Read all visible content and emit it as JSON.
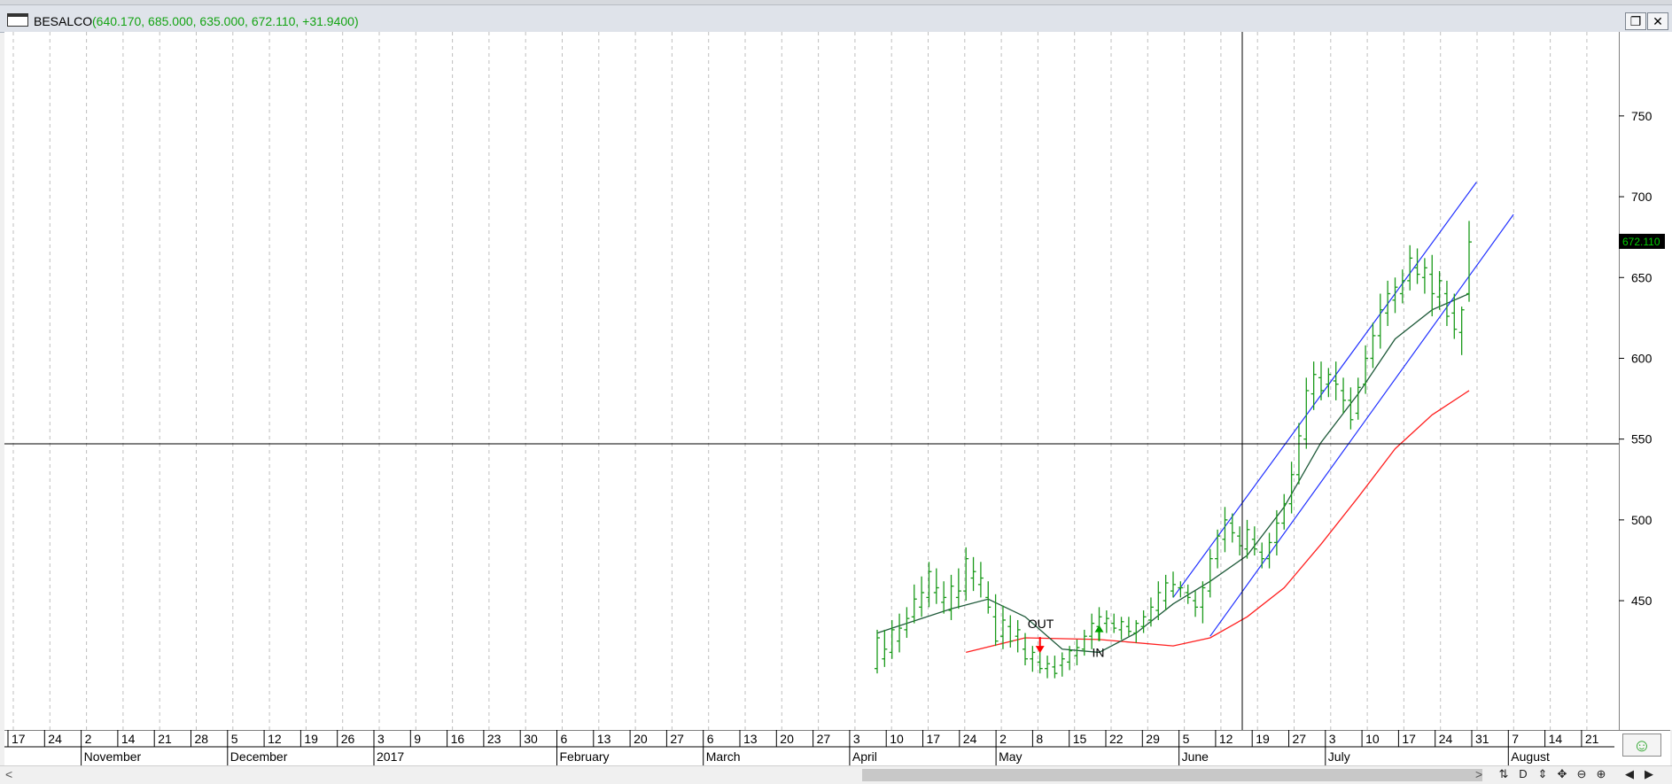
{
  "window": {
    "symbol": "BESALCO",
    "ohlc_text": "(640.170, 685.000, 635.000, 672.110, +31.9400)",
    "restore_glyph": "❐",
    "close_glyph": "✕"
  },
  "toolbar": {
    "scroll_left_glyph": "<",
    "scroll_right_glyph": ">",
    "tools": [
      "⇅",
      "D",
      "⇕",
      "✥",
      "⊖",
      "⊕",
      "◀",
      "▶"
    ],
    "smile_glyph": "☺"
  },
  "chart_data": {
    "type": "bar",
    "price_label": "672.110",
    "price_label_color": "#00cc00",
    "bar_color": "#1a9a1a",
    "ylim": [
      370,
      802
    ],
    "yticks": [
      450,
      500,
      550,
      600,
      650,
      700,
      750
    ],
    "x_day_ticks": [
      "17",
      "24",
      "2",
      "14",
      "21",
      "28",
      "5",
      "12",
      "19",
      "26",
      "3",
      "9",
      "16",
      "23",
      "30",
      "6",
      "13",
      "20",
      "27",
      "6",
      "13",
      "20",
      "27",
      "3",
      "10",
      "17",
      "24",
      "2",
      "8",
      "15",
      "22",
      "29",
      "5",
      "12",
      "19",
      "27",
      "3",
      "10",
      "17",
      "24",
      "31",
      "7",
      "14",
      "21"
    ],
    "month_labels": [
      "November",
      "December",
      "2017",
      "February",
      "March",
      "April",
      "May",
      "June",
      "July",
      "August"
    ],
    "annotations": [
      {
        "text": "OUT",
        "arrow": "down",
        "color": "#ff0000"
      },
      {
        "text": "IN",
        "arrow": "up",
        "color": "#00a000"
      }
    ],
    "ohlc_bars": [
      [
        408,
        432,
        405,
        427
      ],
      [
        414,
        432,
        409,
        420
      ],
      [
        418,
        438,
        414,
        432
      ],
      [
        425,
        442,
        418,
        433
      ],
      [
        432,
        446,
        427,
        439
      ],
      [
        440,
        460,
        436,
        451
      ],
      [
        446,
        465,
        440,
        455
      ],
      [
        452,
        474,
        446,
        468
      ],
      [
        455,
        470,
        448,
        458
      ],
      [
        449,
        462,
        442,
        452
      ],
      [
        444,
        466,
        438,
        459
      ],
      [
        452,
        470,
        445,
        456
      ],
      [
        456,
        483,
        450,
        476
      ],
      [
        464,
        477,
        456,
        468
      ],
      [
        460,
        474,
        452,
        464
      ],
      [
        452,
        462,
        442,
        446
      ],
      [
        440,
        454,
        422,
        425
      ],
      [
        428,
        447,
        420,
        438
      ],
      [
        434,
        441,
        421,
        425
      ],
      [
        428,
        438,
        418,
        432
      ],
      [
        420,
        430,
        410,
        414
      ],
      [
        414,
        422,
        406,
        418
      ],
      [
        412,
        420,
        405,
        408
      ],
      [
        408,
        416,
        402,
        411
      ],
      [
        409,
        416,
        402,
        405
      ],
      [
        410,
        418,
        403,
        414
      ],
      [
        412,
        422,
        407,
        419
      ],
      [
        416,
        426,
        410,
        421
      ],
      [
        420,
        432,
        416,
        428
      ],
      [
        428,
        442,
        420,
        436
      ],
      [
        434,
        446,
        428,
        440
      ],
      [
        436,
        444,
        430,
        439
      ],
      [
        436,
        442,
        430,
        433
      ],
      [
        432,
        440,
        426,
        437
      ],
      [
        434,
        440,
        428,
        431
      ],
      [
        430,
        438,
        424,
        436
      ],
      [
        434,
        444,
        430,
        440
      ],
      [
        438,
        452,
        434,
        446
      ],
      [
        444,
        462,
        438,
        455
      ],
      [
        450,
        466,
        444,
        461
      ],
      [
        456,
        468,
        452,
        460
      ],
      [
        458,
        462,
        452,
        458
      ],
      [
        455,
        460,
        448,
        452
      ],
      [
        450,
        456,
        440,
        446
      ],
      [
        446,
        462,
        436,
        458
      ],
      [
        456,
        482,
        452,
        476
      ],
      [
        476,
        494,
        470,
        490
      ],
      [
        488,
        508,
        480,
        500
      ],
      [
        498,
        504,
        486,
        492
      ],
      [
        490,
        496,
        478,
        484
      ],
      [
        482,
        500,
        476,
        494
      ],
      [
        488,
        496,
        478,
        482
      ],
      [
        480,
        486,
        470,
        476
      ],
      [
        476,
        492,
        470,
        486
      ],
      [
        486,
        506,
        478,
        498
      ],
      [
        498,
        516,
        494,
        510
      ],
      [
        510,
        536,
        504,
        528
      ],
      [
        528,
        560,
        522,
        552
      ],
      [
        550,
        588,
        544,
        580
      ],
      [
        578,
        598,
        568,
        590
      ],
      [
        588,
        598,
        574,
        580
      ],
      [
        584,
        594,
        576,
        590
      ],
      [
        586,
        598,
        574,
        584
      ],
      [
        580,
        588,
        566,
        574
      ],
      [
        574,
        582,
        556,
        562
      ],
      [
        566,
        588,
        562,
        582
      ],
      [
        584,
        608,
        578,
        600
      ],
      [
        600,
        622,
        594,
        614
      ],
      [
        614,
        640,
        606,
        630
      ],
      [
        628,
        648,
        620,
        640
      ],
      [
        636,
        650,
        628,
        644
      ],
      [
        640,
        655,
        634,
        648
      ],
      [
        648,
        670,
        642,
        662
      ],
      [
        656,
        668,
        646,
        652
      ],
      [
        650,
        662,
        640,
        656
      ],
      [
        652,
        664,
        626,
        640
      ],
      [
        638,
        654,
        630,
        648
      ],
      [
        640,
        648,
        620,
        626
      ],
      [
        628,
        640,
        612,
        618
      ],
      [
        616,
        632,
        602,
        630
      ],
      [
        640,
        685,
        635,
        672
      ]
    ],
    "ma_short": [
      [
        0,
        430
      ],
      [
        10,
        445
      ],
      [
        15,
        451
      ],
      [
        20,
        440
      ],
      [
        25,
        420
      ],
      [
        30,
        418
      ],
      [
        35,
        430
      ],
      [
        40,
        448
      ],
      [
        45,
        462
      ],
      [
        50,
        478
      ],
      [
        55,
        508
      ],
      [
        60,
        548
      ],
      [
        65,
        578
      ],
      [
        70,
        612
      ],
      [
        75,
        630
      ],
      [
        80,
        640
      ]
    ],
    "ma_long": [
      [
        12,
        418
      ],
      [
        20,
        427
      ],
      [
        30,
        426
      ],
      [
        40,
        422
      ],
      [
        45,
        427
      ],
      [
        50,
        440
      ],
      [
        55,
        458
      ],
      [
        60,
        485
      ],
      [
        65,
        514
      ],
      [
        70,
        544
      ],
      [
        75,
        565
      ],
      [
        80,
        580
      ]
    ],
    "channel_upper": [
      [
        40,
        452
      ],
      [
        81,
        709
      ]
    ],
    "channel_lower": [
      [
        45,
        428
      ],
      [
        86,
        689
      ]
    ]
  }
}
